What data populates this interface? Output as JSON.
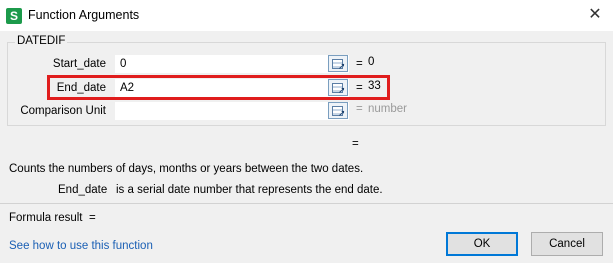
{
  "window": {
    "title": "Function Arguments",
    "icon_letter": "S"
  },
  "group": {
    "title": "DATEDIF"
  },
  "args": [
    {
      "label": "Start_date",
      "value": "0",
      "result": "0"
    },
    {
      "label": "End_date",
      "value": "A2",
      "result": "33"
    },
    {
      "label": "Comparison Unit",
      "value": "",
      "result": "number"
    }
  ],
  "equals": "=",
  "description": "Counts the numbers of days, months or years between the two dates.",
  "arg_description": {
    "name": "End_date",
    "text": "is a serial date number that represents the end date."
  },
  "formula_result": {
    "label": "Formula result",
    "equals": "="
  },
  "help_link": "See how to use this function",
  "buttons": {
    "ok": "OK",
    "cancel": "Cancel"
  },
  "colors": {
    "highlight": "#e01d1d",
    "link": "#1a5fb4",
    "app_icon": "#1c9a4b"
  }
}
